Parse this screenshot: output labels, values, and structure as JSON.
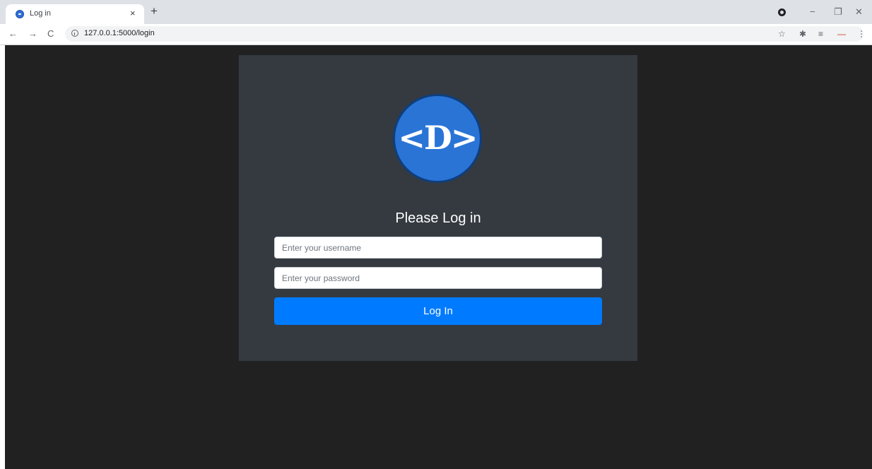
{
  "browser": {
    "tab": {
      "title": "Log in",
      "close_glyph": "×",
      "favicon": "app-logo-favicon"
    },
    "new_tab_glyph": "+",
    "window_controls": {
      "minimize": "−",
      "restore": "❐",
      "close": "✕"
    },
    "nav": {
      "back": "←",
      "forward": "→",
      "reload": "C"
    },
    "address_bar": {
      "url": "127.0.0.1:5000/login",
      "icon": "info-icon"
    },
    "toolbar_icons": {
      "bookmark": "☆",
      "extensions": "✱",
      "media": "≡",
      "extension_minus": "—",
      "menu": "⋮"
    }
  },
  "login": {
    "logo_text": "<D>",
    "heading": "Please Log in",
    "username_placeholder": "Enter your username",
    "password_placeholder": "Enter your password",
    "submit_label": "Log In"
  },
  "colors": {
    "page_background": "#212121",
    "card_background": "#343a40",
    "logo_fill": "#2a74d6",
    "button_primary": "#007bff"
  }
}
